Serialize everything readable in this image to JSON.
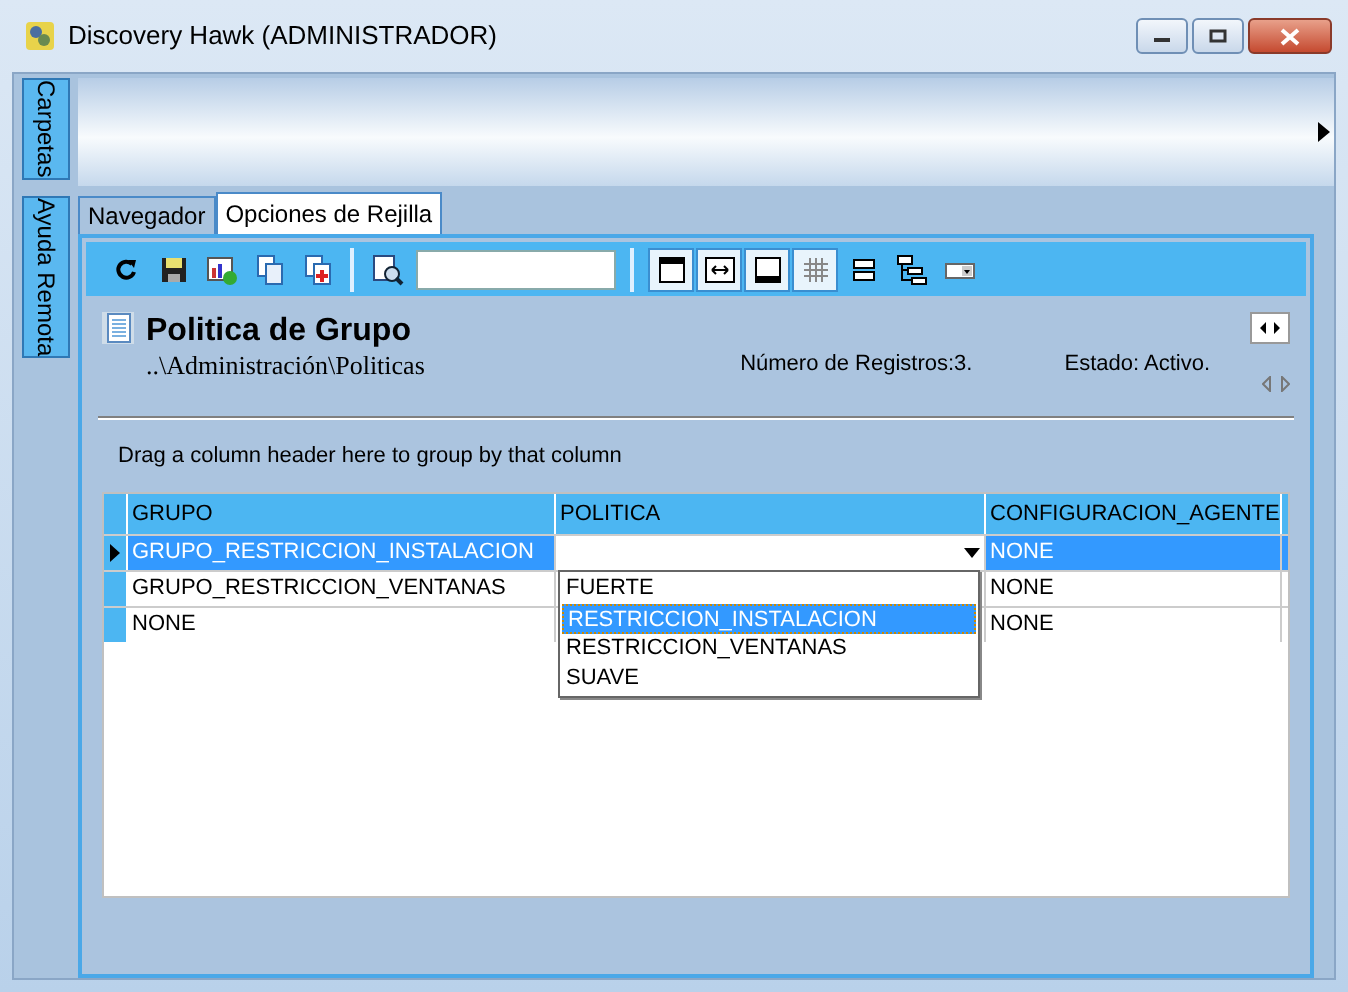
{
  "window": {
    "title": "Discovery Hawk (ADMINISTRADOR)"
  },
  "side_tabs": [
    {
      "label": "Carpetas"
    },
    {
      "label": "Ayuda Remota"
    }
  ],
  "tabs": [
    {
      "label": "Navegador",
      "selected": false
    },
    {
      "label": "Opciones de Rejilla",
      "selected": true
    }
  ],
  "header": {
    "title": "Politica de Grupo",
    "path": "..\\Administración\\Politicas",
    "record_count": "Número de Registros:3.",
    "status": "Estado: Activo."
  },
  "group_hint": "Drag a column header here to group by that column",
  "table": {
    "columns": [
      "GRUPO",
      "POLITICA",
      "CONFIGURACION_AGENTE"
    ],
    "rows": [
      {
        "cells": [
          "GRUPO_RESTRICCION_INSTALACION",
          "",
          "NONE"
        ],
        "selected": true
      },
      {
        "cells": [
          "GRUPO_RESTRICCION_VENTANAS",
          "",
          "NONE"
        ],
        "selected": false
      },
      {
        "cells": [
          "NONE",
          "",
          "NONE"
        ],
        "selected": false
      }
    ]
  },
  "dropdown": {
    "options": [
      {
        "label": "FUERTE",
        "selected": false
      },
      {
        "label": "RESTRICCION_INSTALACION",
        "selected": true
      },
      {
        "label": "RESTRICCION_VENTANAS",
        "selected": false
      },
      {
        "label": "SUAVE",
        "selected": false
      }
    ]
  }
}
